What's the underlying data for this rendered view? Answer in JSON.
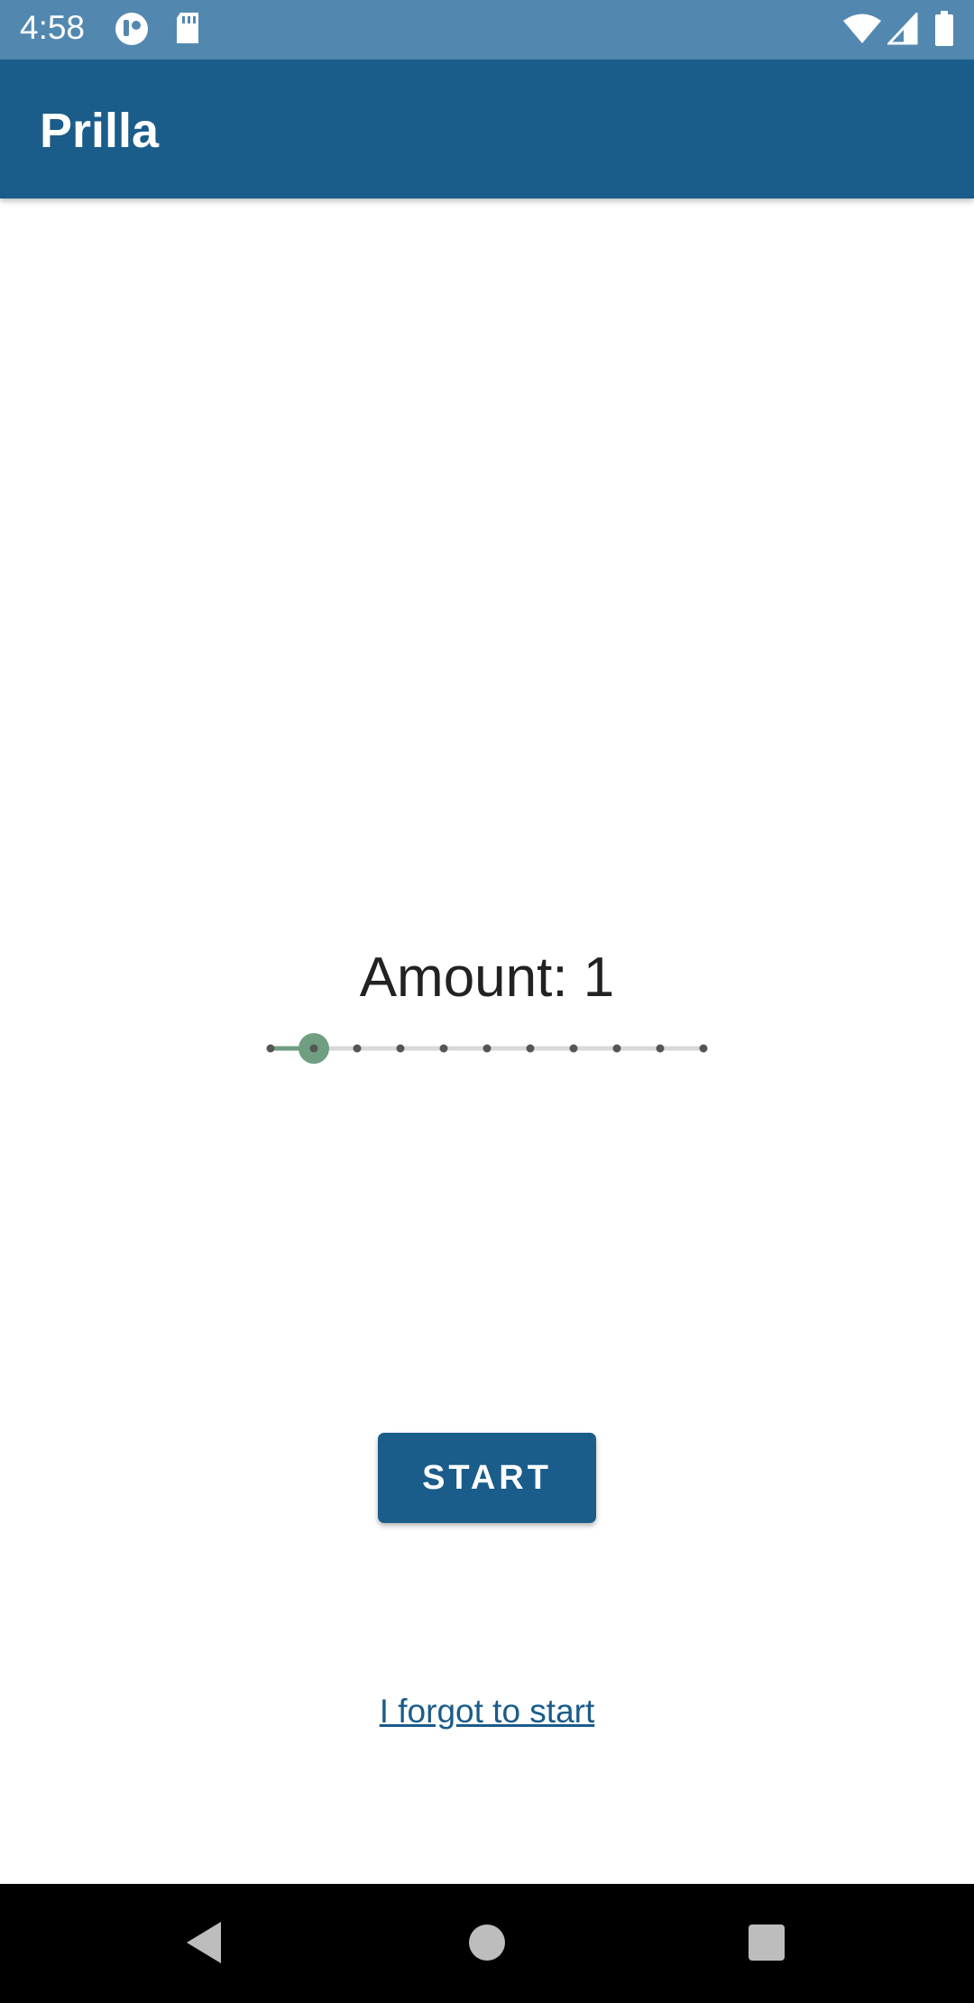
{
  "status_bar": {
    "time": "4:58",
    "left_icons": [
      "notification-app-icon",
      "sd-card-icon"
    ],
    "right_icons": [
      "wifi-icon",
      "cell-signal-icon",
      "battery-icon"
    ]
  },
  "app_bar": {
    "title": "Prilla",
    "color": "#1a5c8a"
  },
  "amount": {
    "label": "Amount: 1",
    "slider": {
      "min": 0,
      "max": 10,
      "step": 1,
      "value": 1,
      "active_color": "#6f9e80",
      "inactive_track_color": "#d9d9d9"
    }
  },
  "start_button": {
    "label": "START"
  },
  "forgot_link": {
    "label": "I forgot to start"
  },
  "nav_bar": {
    "buttons": [
      "back-icon",
      "home-icon",
      "recents-icon"
    ]
  }
}
